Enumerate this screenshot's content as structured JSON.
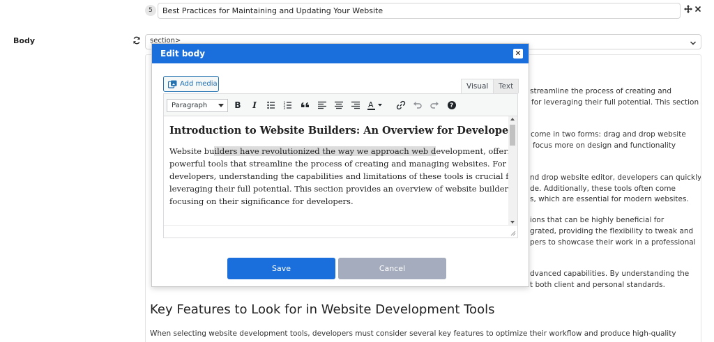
{
  "title_row": {
    "number": "5",
    "title_value": "Best Practices for Maintaining and Updating Your Website"
  },
  "body_field": {
    "label": "Body",
    "select_value": "section>"
  },
  "preview": {
    "lines": [
      "streamline the process of creating and",
      "for leveraging their full potential. This section",
      "come in two forms: drag and drop website",
      "focus more on design and functionality",
      "nd drop website editor, developers can quickly",
      "de. Additionally, these tools often come",
      "s, which are essential for modern websites.",
      "ions that can be highly beneficial for",
      "grated, providing the flexibility to tweak and",
      "pers to showcase their work in a professional",
      "dvanced capabilities. By understanding the",
      "t both client and personal standards."
    ],
    "heading": "Key Features to Look for in Website Development Tools",
    "bottom_line": "When selecting website development tools, developers must consider several key features to optimize their workflow and produce high-quality"
  },
  "modal": {
    "title": "Edit body",
    "close_label": "✕",
    "add_media_label": "Add media",
    "tabs": {
      "visual": "Visual",
      "text": "Text"
    },
    "format_select": "Paragraph",
    "content": {
      "heading": "Introduction to Website Builders: An Overview for Developers",
      "para_line1_a": "Website bu",
      "para_line1_hl": "ilders have revolutionized the way we approach web d",
      "para_line1_b": "evelopment, offering",
      "para_lines": [
        "powerful tools that streamline the process of creating and managing websites. For",
        "developers, understanding the capabilities and limitations of these tools is crucial for",
        "leveraging their full potential. This section provides an overview of website builders,",
        "focusing on their significance for developers."
      ]
    },
    "save_label": "Save",
    "cancel_label": "Cancel"
  },
  "colors": {
    "accent": "#1a6fdc",
    "cancel": "#a4acbd"
  }
}
